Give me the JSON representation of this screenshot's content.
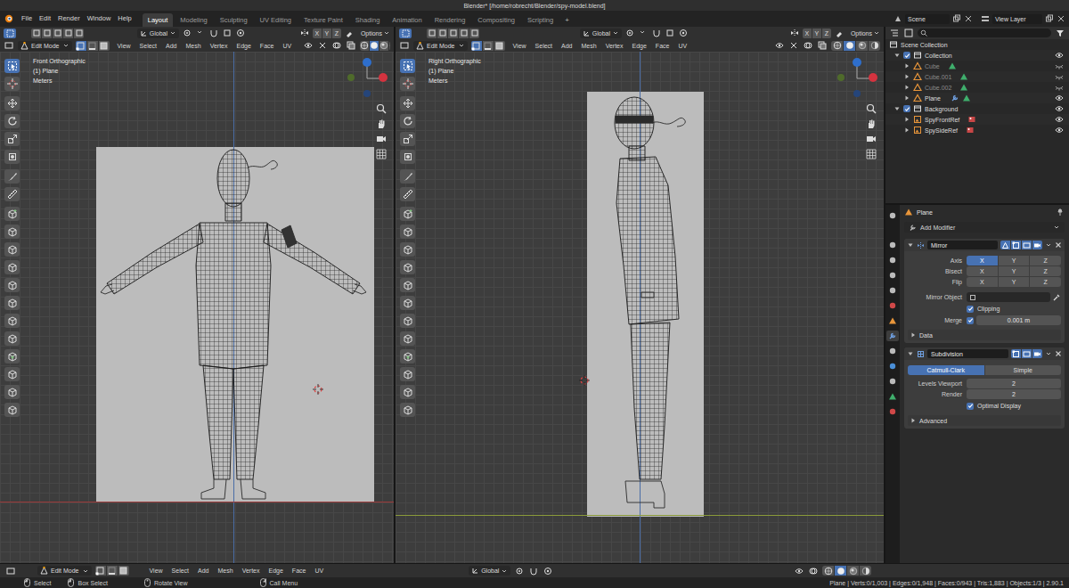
{
  "window": {
    "title": "Blender* [/home/robrecht/Blender/spy-model.blend]"
  },
  "menu": [
    "File",
    "Edit",
    "Render",
    "Window",
    "Help"
  ],
  "workspaces": [
    {
      "label": "Layout",
      "selected": true
    },
    {
      "label": "Modeling",
      "selected": false
    },
    {
      "label": "Sculpting",
      "selected": false
    },
    {
      "label": "UV Editing",
      "selected": false
    },
    {
      "label": "Texture Paint",
      "selected": false
    },
    {
      "label": "Shading",
      "selected": false
    },
    {
      "label": "Animation",
      "selected": false
    },
    {
      "label": "Rendering",
      "selected": false
    },
    {
      "label": "Compositing",
      "selected": false
    },
    {
      "label": "Scripting",
      "selected": false
    }
  ],
  "add_workspace": "+",
  "scene": {
    "label": "Scene"
  },
  "view_layer": {
    "label": "View Layer"
  },
  "viewports": [
    {
      "mode": "Edit Mode",
      "select_mode": [
        {
          "kind": "vertex",
          "selected": true
        },
        {
          "kind": "edge",
          "selected": false
        },
        {
          "kind": "face",
          "selected": false
        }
      ],
      "menus": [
        "View",
        "Select",
        "Add",
        "Mesh",
        "Vertex",
        "Edge",
        "Face",
        "UV"
      ],
      "orientation": "Global",
      "mirror_axes": [
        {
          "label": "X",
          "on": false
        },
        {
          "label": "Y",
          "on": false
        },
        {
          "label": "Z",
          "on": false
        }
      ],
      "options": "Options",
      "shading": [
        {
          "kind": "wireframe",
          "selected": false
        },
        {
          "kind": "solid",
          "selected": true
        },
        {
          "kind": "material",
          "selected": false
        },
        {
          "kind": "rendered",
          "selected": false
        }
      ],
      "view": "Front Orthographic",
      "object": "(1) Plane",
      "units": "Meters",
      "tools": [
        {
          "kind": "select",
          "selected": true
        },
        {
          "kind": "cursor",
          "selected": false
        },
        {
          "kind": "move",
          "selected": false
        },
        {
          "kind": "rotate",
          "selected": false
        },
        {
          "kind": "scale",
          "selected": false
        },
        {
          "kind": "transform",
          "selected": false
        },
        {
          "kind": "annotate",
          "selected": false
        },
        {
          "kind": "measure",
          "selected": false
        },
        {
          "kind": "add_cube",
          "selected": false
        },
        {
          "kind": "extrude",
          "selected": false
        },
        {
          "kind": "inset",
          "selected": false
        },
        {
          "kind": "bevel",
          "selected": false
        },
        {
          "kind": "loop_cut",
          "selected": false
        },
        {
          "kind": "knife",
          "selected": false
        },
        {
          "kind": "poly_build",
          "selected": false
        },
        {
          "kind": "spin",
          "selected": false
        },
        {
          "kind": "smooth",
          "selected": false
        },
        {
          "kind": "edge_slide",
          "selected": false
        },
        {
          "kind": "shrink",
          "selected": false
        },
        {
          "kind": "shear",
          "selected": false
        }
      ]
    },
    {
      "mode": "Edit Mode",
      "select_mode": [
        {
          "kind": "vertex",
          "selected": true
        },
        {
          "kind": "edge",
          "selected": false
        },
        {
          "kind": "face",
          "selected": false
        }
      ],
      "menus": [
        "View",
        "Select",
        "Add",
        "Mesh",
        "Vertex",
        "Edge",
        "Face",
        "UV"
      ],
      "orientation": "Global",
      "mirror_axes": [
        {
          "label": "X",
          "on": false
        },
        {
          "label": "Y",
          "on": false
        },
        {
          "label": "Z",
          "on": false
        }
      ],
      "options": "Options",
      "shading": [
        {
          "kind": "wireframe",
          "selected": false
        },
        {
          "kind": "solid",
          "selected": true
        },
        {
          "kind": "material",
          "selected": false
        },
        {
          "kind": "rendered",
          "selected": false
        }
      ],
      "view": "Right Orthographic",
      "object": "(1) Plane",
      "units": "Meters",
      "tools": [
        {
          "kind": "select",
          "selected": true
        },
        {
          "kind": "cursor",
          "selected": false
        },
        {
          "kind": "move",
          "selected": false
        },
        {
          "kind": "rotate",
          "selected": false
        },
        {
          "kind": "scale",
          "selected": false
        },
        {
          "kind": "transform",
          "selected": false
        },
        {
          "kind": "annotate",
          "selected": false
        },
        {
          "kind": "measure",
          "selected": false
        },
        {
          "kind": "add_cube",
          "selected": false
        },
        {
          "kind": "extrude",
          "selected": false
        },
        {
          "kind": "inset",
          "selected": false
        },
        {
          "kind": "bevel",
          "selected": false
        },
        {
          "kind": "loop_cut",
          "selected": false
        },
        {
          "kind": "knife",
          "selected": false
        },
        {
          "kind": "poly_build",
          "selected": false
        },
        {
          "kind": "spin",
          "selected": false
        },
        {
          "kind": "smooth",
          "selected": false
        },
        {
          "kind": "edge_slide",
          "selected": false
        },
        {
          "kind": "shrink",
          "selected": false
        },
        {
          "kind": "shear",
          "selected": false
        }
      ]
    }
  ],
  "outliner": {
    "root": "Scene Collection",
    "collections": [
      {
        "label": "Collection",
        "checked": true,
        "expanded": true,
        "objects": [
          {
            "label": "Cube",
            "kind": "mesh",
            "hidden": true,
            "has_modifiers": false,
            "expanded": false
          },
          {
            "label": "Cube.001",
            "kind": "mesh",
            "hidden": true,
            "has_modifiers": false,
            "expanded": false
          },
          {
            "label": "Cube.002",
            "kind": "mesh",
            "hidden": true,
            "has_modifiers": false,
            "expanded": false
          },
          {
            "label": "Plane",
            "kind": "mesh",
            "hidden": false,
            "has_modifiers": true,
            "expanded": false
          }
        ]
      },
      {
        "label": "Background",
        "checked": true,
        "expanded": true,
        "objects": [
          {
            "label": "SpyFrontRef",
            "kind": "image",
            "hidden": false,
            "has_modifiers": false,
            "expanded": false
          },
          {
            "label": "SpySideRef",
            "kind": "image",
            "hidden": false,
            "has_modifiers": false,
            "expanded": false
          }
        ]
      }
    ]
  },
  "property_tabs": [
    {
      "kind": "tool",
      "selected": false
    },
    {
      "kind": "render",
      "selected": false
    },
    {
      "kind": "output",
      "selected": false
    },
    {
      "kind": "view_layer",
      "selected": false
    },
    {
      "kind": "scene",
      "selected": false
    },
    {
      "kind": "world",
      "selected": false
    },
    {
      "kind": "object",
      "selected": false
    },
    {
      "kind": "modifiers",
      "selected": true
    },
    {
      "kind": "particles",
      "selected": false
    },
    {
      "kind": "physics",
      "selected": false
    },
    {
      "kind": "constraints",
      "selected": false
    },
    {
      "kind": "data",
      "selected": false
    },
    {
      "kind": "material",
      "selected": false
    }
  ],
  "properties": {
    "object": "Plane",
    "add_modifier": "Add Modifier",
    "modifiers": [
      {
        "name": "Mirror",
        "kind": "mirror",
        "expanded": true,
        "toggles": [
          {
            "kind": "cage",
            "on": true
          },
          {
            "kind": "edit_mode",
            "on": true
          },
          {
            "kind": "viewport",
            "on": true
          },
          {
            "kind": "render",
            "on": true
          }
        ],
        "rows": [
          {
            "kind": "axes",
            "label": "Axis",
            "buttons": [
              {
                "label": "X",
                "on": true
              },
              {
                "label": "Y",
                "on": false
              },
              {
                "label": "Z",
                "on": false
              }
            ]
          },
          {
            "kind": "axes",
            "label": "Bisect",
            "buttons": [
              {
                "label": "X",
                "on": false
              },
              {
                "label": "Y",
                "on": false
              },
              {
                "label": "Z",
                "on": false
              }
            ]
          },
          {
            "kind": "axes",
            "label": "Flip",
            "buttons": [
              {
                "label": "X",
                "on": false
              },
              {
                "label": "Y",
                "on": false
              },
              {
                "label": "Z",
                "on": false
              }
            ]
          },
          {
            "kind": "object",
            "label": "Mirror Object"
          },
          {
            "kind": "check",
            "label": "Clipping",
            "checked": true
          },
          {
            "kind": "check_field",
            "label": "Merge",
            "checked": true,
            "value": "0.001 m"
          },
          {
            "kind": "subpanel",
            "label": "Data",
            "expanded": false
          }
        ]
      },
      {
        "name": "Subdivision",
        "kind": "subdivision",
        "expanded": true,
        "toggles": [
          {
            "kind": "edit_mode",
            "on": true
          },
          {
            "kind": "viewport",
            "on": true
          },
          {
            "kind": "render",
            "on": true
          }
        ],
        "rows": [
          {
            "kind": "segmented",
            "buttons": [
              {
                "label": "Catmull-Clark",
                "on": true
              },
              {
                "label": "Simple",
                "on": false
              }
            ]
          },
          {
            "kind": "field",
            "label": "Levels Viewport",
            "value": "2"
          },
          {
            "kind": "field",
            "label": "Render",
            "value": "2"
          },
          {
            "kind": "check",
            "label": "Optimal Display",
            "checked": true
          },
          {
            "kind": "subpanel",
            "label": "Advanced",
            "expanded": false
          }
        ]
      }
    ]
  },
  "bottom_header": {
    "mode": "Edit Mode",
    "menus": [
      "View",
      "Select",
      "Add",
      "Mesh",
      "Vertex",
      "Edge",
      "Face",
      "UV"
    ],
    "orientation": "Global",
    "shading": [
      {
        "kind": "wireframe",
        "selected": false
      },
      {
        "kind": "solid",
        "selected": true
      },
      {
        "kind": "material",
        "selected": false
      },
      {
        "kind": "rendered",
        "selected": false
      }
    ]
  },
  "status_bar": {
    "hints": [
      "Select",
      "Box Select",
      "Rotate View",
      "Call Menu"
    ],
    "stats": "Plane | Verts:0/1,003 | Edges:0/1,948 | Faces:0/943 | Tris:1,883 | Objects:1/3 | 2.90.1"
  }
}
